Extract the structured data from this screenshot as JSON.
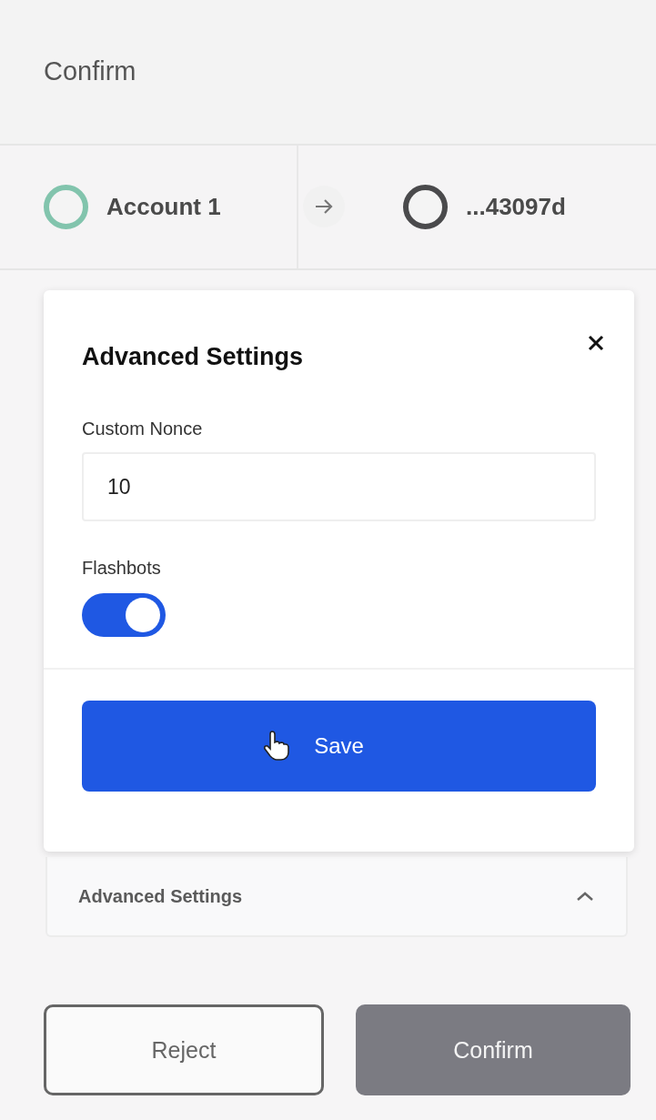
{
  "header": {
    "title": "Confirm"
  },
  "accounts": [
    {
      "name": "Account 1",
      "color": "#82c4ad"
    },
    {
      "name": "...43097d",
      "color": "#4a4a4c"
    }
  ],
  "settings_dialog": {
    "title": "Advanced Settings",
    "nonce": {
      "label": "Custom Nonce",
      "value": "10"
    },
    "flashbots": {
      "label": "Flashbots",
      "on": true
    },
    "save_button": "Save"
  },
  "accordion": {
    "title": "Advanced Settings",
    "expanded": true
  },
  "buttons": [
    {
      "label": "Reject",
      "disabled": false,
      "kind": "secondary"
    },
    {
      "label": "Confirm",
      "disabled": true,
      "kind": "primary"
    }
  ]
}
